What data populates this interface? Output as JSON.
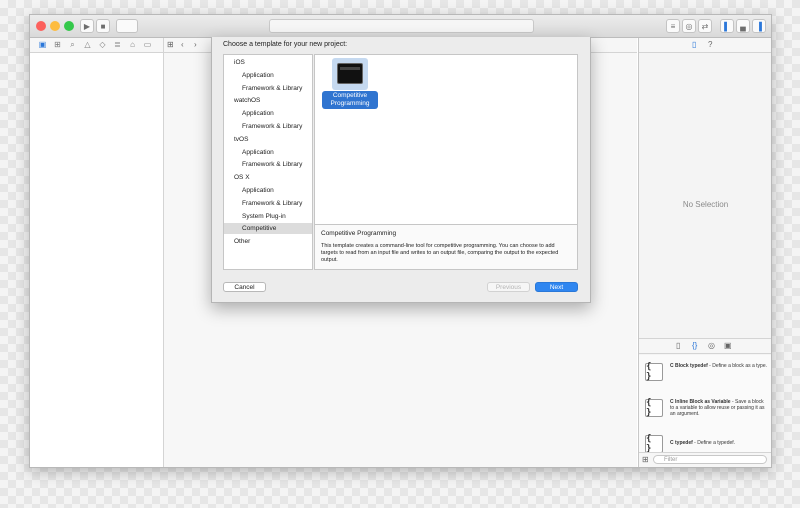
{
  "dialog": {
    "title": "Choose a template for your new project:",
    "categories": [
      {
        "label": "iOS",
        "kind": "platform"
      },
      {
        "label": "Application",
        "kind": "sub"
      },
      {
        "label": "Framework & Library",
        "kind": "sub"
      },
      {
        "label": "watchOS",
        "kind": "platform"
      },
      {
        "label": "Application",
        "kind": "sub"
      },
      {
        "label": "Framework & Library",
        "kind": "sub"
      },
      {
        "label": "tvOS",
        "kind": "platform"
      },
      {
        "label": "Application",
        "kind": "sub"
      },
      {
        "label": "Framework & Library",
        "kind": "sub"
      },
      {
        "label": "OS X",
        "kind": "platform"
      },
      {
        "label": "Application",
        "kind": "sub"
      },
      {
        "label": "Framework & Library",
        "kind": "sub"
      },
      {
        "label": "System Plug-in",
        "kind": "sub"
      },
      {
        "label": "Competitive",
        "kind": "sub",
        "selected": true
      },
      {
        "label": "Other",
        "kind": "platform"
      }
    ],
    "template": {
      "label": "Competitive Programming",
      "icon": "terminal-icon"
    },
    "description": {
      "title": "Competitive Programming",
      "body": "This template creates a command-line tool for competitive programming. You can choose to add targets to read from an input file and writes to an output file, comparing the output to the expected output."
    },
    "buttons": {
      "cancel": "Cancel",
      "previous": "Previous",
      "next": "Next"
    }
  },
  "inspector": {
    "empty_text": "No Selection"
  },
  "library": {
    "snippets": [
      {
        "icon": "{ }",
        "title": "C Block typedef",
        "desc": " - Define a block as a type."
      },
      {
        "icon": "{ }",
        "title": "C Inline Block as Variable",
        "desc": " - Save a block to a variable to allow reuse or passing it as an argument."
      },
      {
        "icon": "{ }",
        "title": "C typedef",
        "desc": " - Define a typedef."
      }
    ],
    "filter_placeholder": "Filter"
  },
  "colors": {
    "accent": "#2f86f0",
    "selection": "#2f74d0",
    "close": "#fc605c",
    "minimize": "#fdbc40",
    "zoom": "#34c84a"
  }
}
